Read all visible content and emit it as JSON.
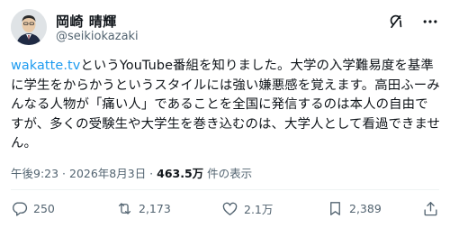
{
  "author": {
    "display_name": "岡崎 晴輝",
    "handle": "@seikiokazaki"
  },
  "post": {
    "link_text": "wakatte.tv",
    "text_after_link": "というYouTube番組を知りました。大学の入学難易度を基準に学生をからかうというスタイルには強い嫌悪感を覚えます。高田ふーみんなる人物が「痛い人」であることを全国に発信するのは本人の自由ですが、多くの受験生や大学生を巻き込むのは、大学人として看過できません。"
  },
  "meta": {
    "time_date": "午後9:23 · 2026年8月3日 · ",
    "views": "463.5万",
    "views_suffix": " 件の表示"
  },
  "actions": {
    "replies": "250",
    "reposts": "2,173",
    "likes": "2.1万",
    "bookmarks": "2,389"
  },
  "icons": {
    "grok": "grok-icon",
    "more": "more-icon",
    "reply": "reply-icon",
    "repost": "repost-icon",
    "like": "like-icon",
    "bookmark": "bookmark-icon",
    "share": "share-icon"
  },
  "colors": {
    "link": "#1d9bf0",
    "secondary_text": "#536471",
    "primary_text": "#0f1419"
  }
}
